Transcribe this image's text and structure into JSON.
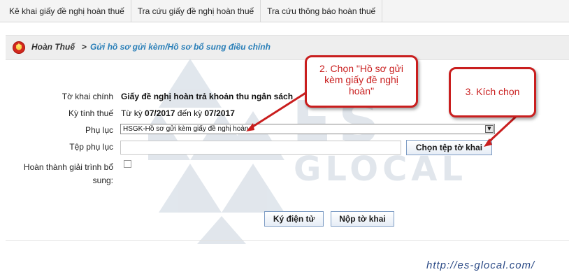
{
  "tabs": [
    {
      "label": "Kê khai giấy đề nghị hoàn thuế"
    },
    {
      "label": "Tra cứu giấy đề nghị hoàn thuế"
    },
    {
      "label": "Tra cứu thông báo hoàn thuế"
    }
  ],
  "breadcrumb": {
    "root": "Hoàn Thuế",
    "separator": ">",
    "current": "Gửi hồ sơ gửi kèm/Hồ sơ bổ sung điều chỉnh"
  },
  "form": {
    "to_khai_label": "Tờ khai chính",
    "to_khai_value": "Giấy đề nghị hoàn trả khoản thu ngân sách",
    "ky_tinh_thue_label": "Kỳ tính thuế",
    "ky_from_prefix": "Từ kỳ",
    "ky_from": "07/2017",
    "ky_to_prefix": "đến kỳ",
    "ky_to": "07/2017",
    "phu_luc_label": "Phụ lục",
    "phu_luc_selected": "HSGK-Hồ sơ gửi kèm giấy đề nghị hoàn",
    "tep_phu_luc_label": "Tệp phụ lục",
    "tep_phu_luc_value": "",
    "choose_file_button": "Chọn tệp tờ khai",
    "hoan_thanh_label_1": "Hoàn thành giải trình bổ",
    "hoan_thanh_label_2": "sung:",
    "hoan_thanh_checked": false
  },
  "actions": {
    "sign_button": "Ký điện tử",
    "submit_button": "Nộp tờ khai"
  },
  "callouts": {
    "step2": "2. Chọn \"Hồ sơ gửi kèm giấy đề nghị hoàn\"",
    "step3": "3. Kích chọn"
  },
  "watermark": {
    "line1": "ES",
    "line2": "GLOCAL",
    "url": "http://es-glocal.com/"
  },
  "colors": {
    "accent_blue": "#2a7fb8",
    "callout_red": "#c91e1e",
    "button_border": "#7d9cc4"
  }
}
